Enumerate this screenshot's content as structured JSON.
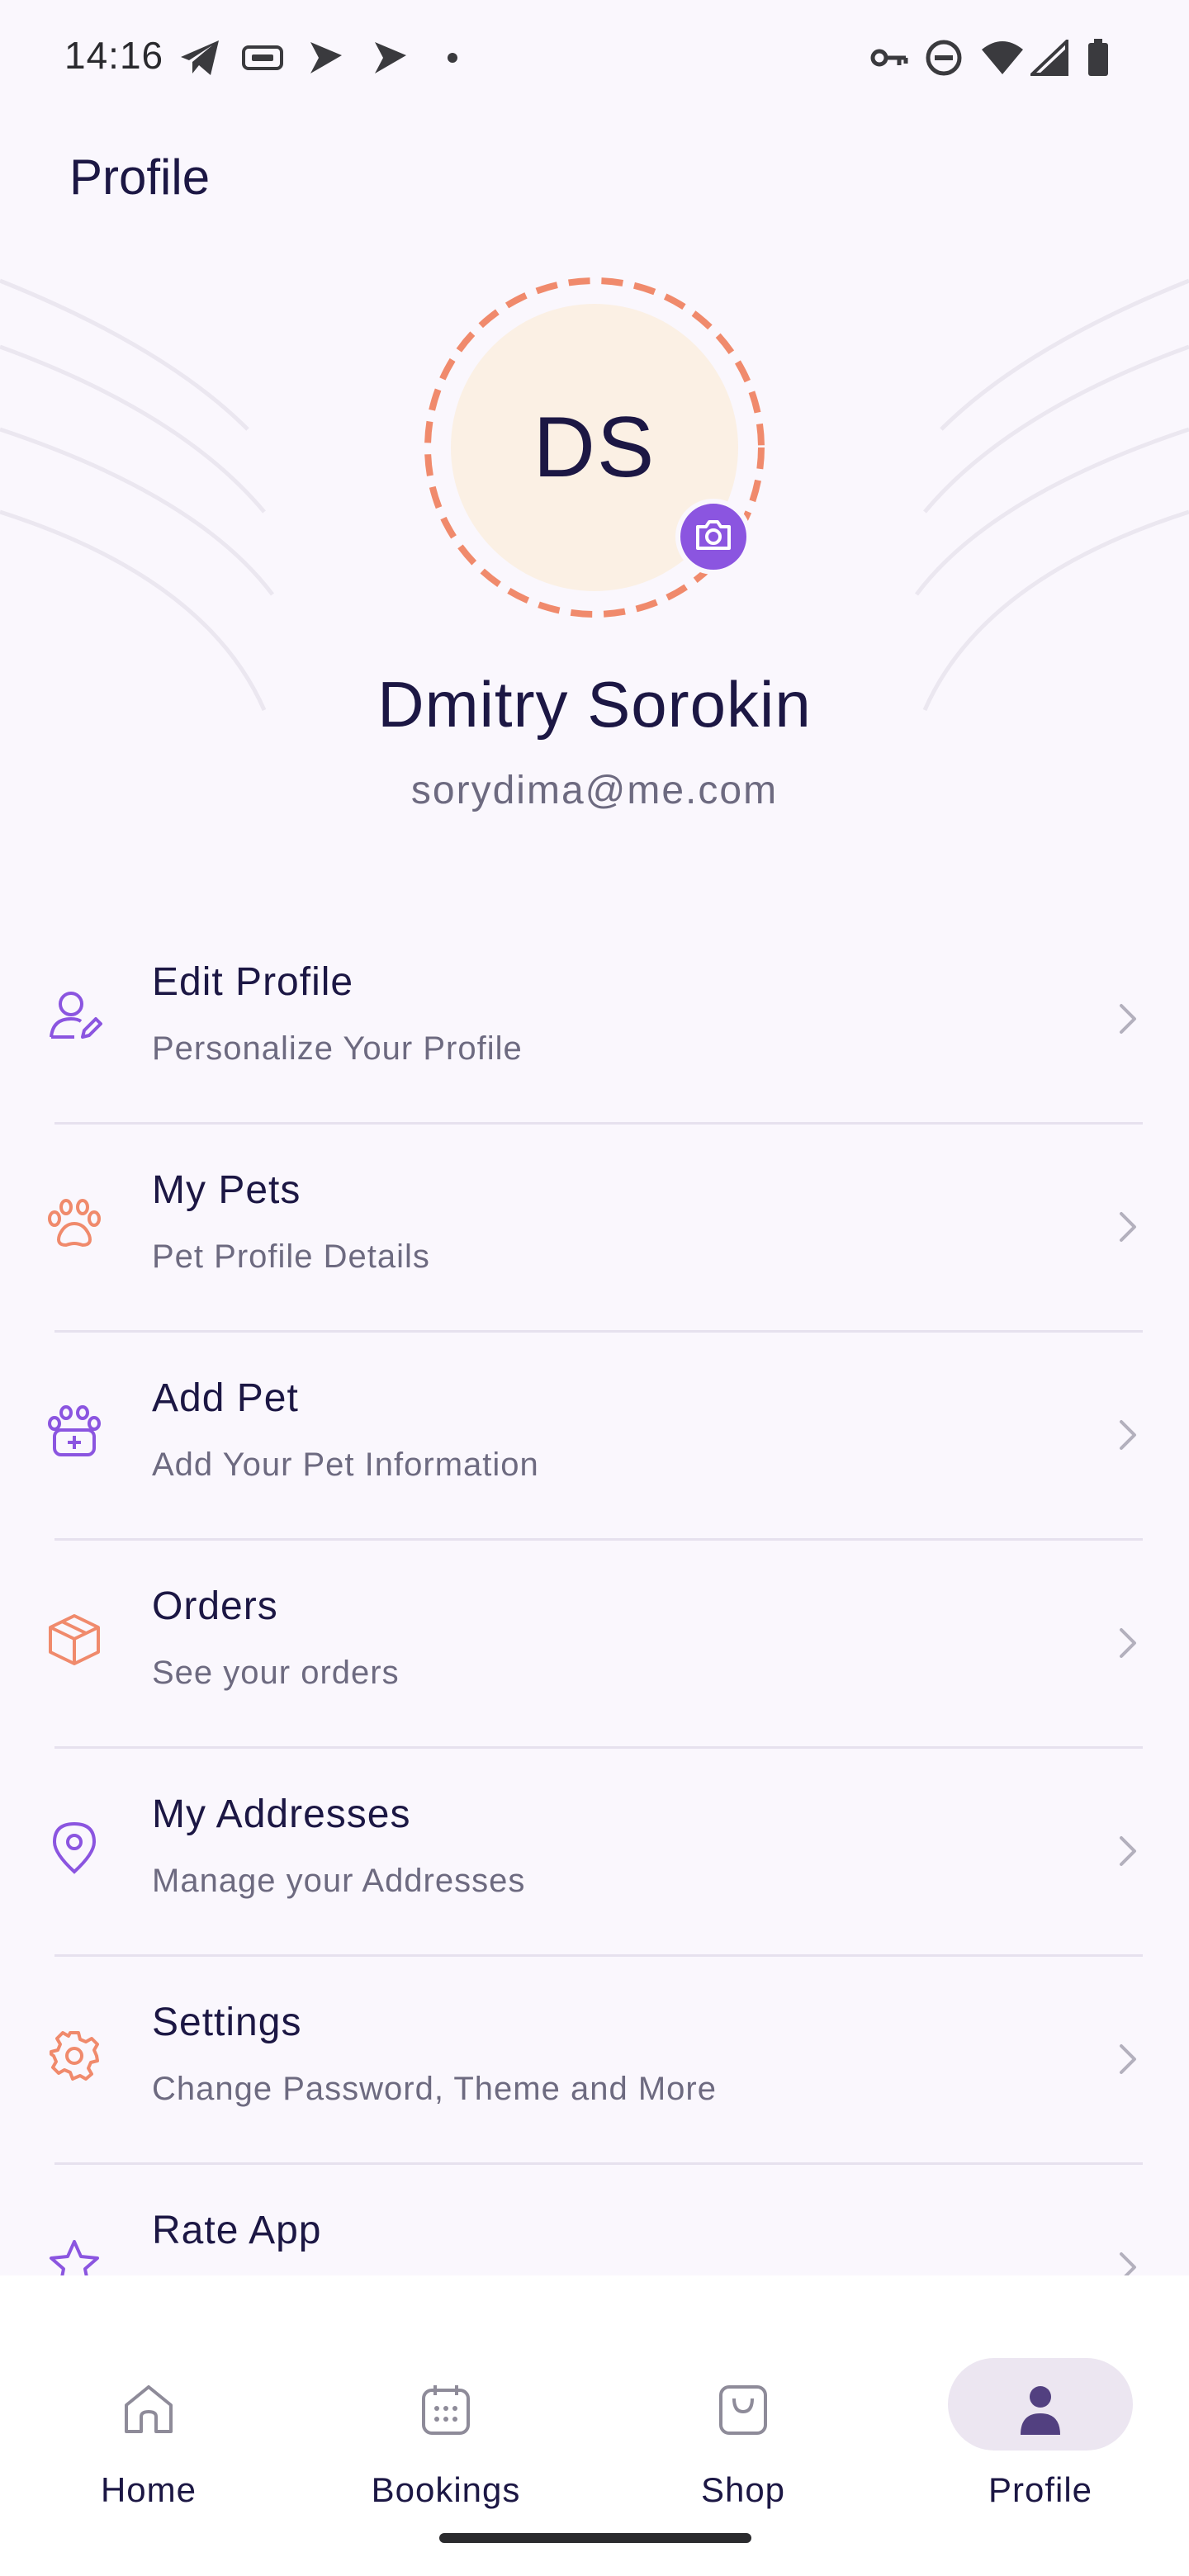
{
  "status_bar": {
    "time": "14:16",
    "icons_left": [
      "telegram-icon",
      "tag-icon",
      "play-icon",
      "play-icon",
      "dot-icon"
    ],
    "icons_right": [
      "vpn-key-icon",
      "do-not-disturb-icon",
      "wifi-icon",
      "signal-icon",
      "battery-icon"
    ]
  },
  "header": {
    "title": "Profile"
  },
  "profile": {
    "initials": "DS",
    "name": "Dmitry Sorokin",
    "email": "sorydima@me.com",
    "ring_color": "#f08a6c",
    "avatar_bg": "#fbf0e4",
    "camera_bg": "#8b55e0"
  },
  "menu": {
    "items": [
      {
        "title": "Edit Profile",
        "subtitle": "Personalize Your Profile",
        "icon": "user-edit-icon",
        "color": "#8b55e0"
      },
      {
        "title": "My Pets",
        "subtitle": "Pet Profile Details",
        "icon": "paw-icon",
        "color": "#f08a6c"
      },
      {
        "title": "Add Pet",
        "subtitle": "Add Your Pet Information",
        "icon": "paw-plus-icon",
        "color": "#8b55e0"
      },
      {
        "title": "Orders",
        "subtitle": "See your orders",
        "icon": "box-icon",
        "color": "#f08a6c"
      },
      {
        "title": "My Addresses",
        "subtitle": "Manage your Addresses",
        "icon": "location-pin-icon",
        "color": "#8b55e0"
      },
      {
        "title": "Settings",
        "subtitle": "Change Password, Theme and More",
        "icon": "gear-icon",
        "color": "#f08a6c"
      },
      {
        "title": "Rate App",
        "subtitle": "",
        "icon": "star-icon",
        "color": "#8b55e0"
      }
    ]
  },
  "bottom_nav": {
    "items": [
      {
        "label": "Home",
        "icon": "home-icon",
        "active": false
      },
      {
        "label": "Bookings",
        "icon": "calendar-icon",
        "active": false
      },
      {
        "label": "Shop",
        "icon": "shopping-bag-icon",
        "active": false
      },
      {
        "label": "Profile",
        "icon": "person-icon",
        "active": true
      }
    ]
  },
  "colors": {
    "text_primary": "#1c1744",
    "text_secondary": "#6d6a80",
    "accent_purple": "#8b55e0",
    "accent_orange": "#f08a6c",
    "nav_active_pill": "#ece6f1"
  }
}
